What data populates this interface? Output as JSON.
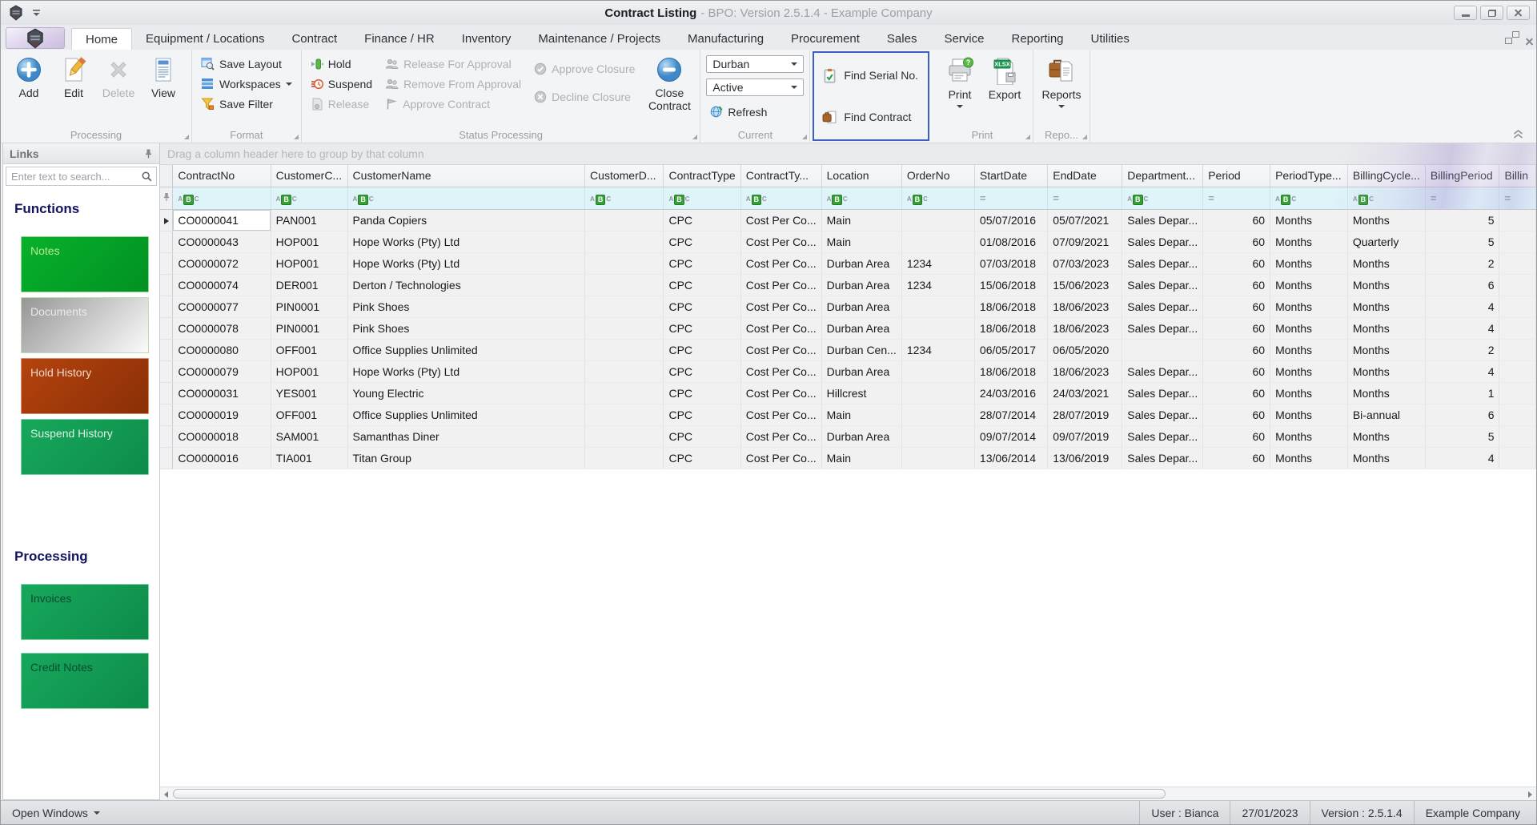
{
  "titlebar": {
    "title": "Contract Listing",
    "subtitle": "- BPO: Version 2.5.1.4 - Example Company"
  },
  "tabs": [
    {
      "label": "Home",
      "active": true
    },
    {
      "label": "Equipment / Locations"
    },
    {
      "label": "Contract"
    },
    {
      "label": "Finance / HR"
    },
    {
      "label": "Inventory"
    },
    {
      "label": "Maintenance / Projects"
    },
    {
      "label": "Manufacturing"
    },
    {
      "label": "Procurement"
    },
    {
      "label": "Sales"
    },
    {
      "label": "Service"
    },
    {
      "label": "Reporting"
    },
    {
      "label": "Utilities"
    }
  ],
  "ribbon": {
    "processing": {
      "label": "Processing",
      "add": "Add",
      "edit": "Edit",
      "del": "Delete",
      "view": "View"
    },
    "format": {
      "label": "Format",
      "save_layout": "Save Layout",
      "workspaces": "Workspaces",
      "save_filter": "Save Filter"
    },
    "status": {
      "label": "Status Processing",
      "hold": "Hold",
      "suspend": "Suspend",
      "release": "Release",
      "release_for_approval": "Release For Approval",
      "remove_from_approval": "Remove From Approval",
      "approve_contract": "Approve Contract",
      "approve_closure": "Approve Closure",
      "decline_closure": "Decline Closure",
      "close_contract": "Close Contract"
    },
    "current": {
      "label": "Current",
      "branch": "Durban",
      "state": "Active",
      "refresh": "Refresh"
    },
    "find": {
      "find_serial": "Find Serial No.",
      "find_contract": "Find Contract"
    },
    "print": {
      "label": "Print",
      "print_btn": "Print",
      "export_btn": "Export",
      "export_badge": "XLSX"
    },
    "reports": {
      "label": "Repo...",
      "reports_btn": "Reports"
    }
  },
  "sidebar": {
    "caption": "Links",
    "search_placeholder": "Enter text to search...",
    "functions": {
      "heading": "Functions",
      "buttons": [
        {
          "label": "Notes",
          "style": "green"
        },
        {
          "label": "Documents",
          "style": "silver"
        },
        {
          "label": "Hold History",
          "style": "rust"
        },
        {
          "label": "Suspend History",
          "style": "emerald"
        }
      ]
    },
    "processing": {
      "heading": "Processing",
      "buttons": [
        {
          "label": "Invoices",
          "style": "emerald2"
        },
        {
          "label": "Credit Notes",
          "style": "emerald2"
        }
      ]
    }
  },
  "grid": {
    "group_hint": "Drag a column header here to group by that column",
    "filter_icons": {
      "abc": [
        "A",
        "B",
        "C"
      ],
      "eq": "="
    },
    "columns": [
      {
        "label": "ContractNo",
        "filter": "abc"
      },
      {
        "label": "CustomerC...",
        "filter": "abc"
      },
      {
        "label": "CustomerName",
        "filter": "abc"
      },
      {
        "label": "CustomerD...",
        "filter": "abc"
      },
      {
        "label": "ContractType",
        "filter": "abc"
      },
      {
        "label": "ContractTy...",
        "filter": "abc"
      },
      {
        "label": "Location",
        "filter": "abc"
      },
      {
        "label": "OrderNo",
        "filter": "abc"
      },
      {
        "label": "StartDate",
        "filter": "eq"
      },
      {
        "label": "EndDate",
        "filter": "eq"
      },
      {
        "label": "Department...",
        "filter": "abc"
      },
      {
        "label": "Period",
        "filter": "eq",
        "align": "right"
      },
      {
        "label": "PeriodType...",
        "filter": "abc"
      },
      {
        "label": "BillingCycle...",
        "filter": "abc"
      },
      {
        "label": "BillingPeriod",
        "filter": "eq",
        "align": "right"
      },
      {
        "label": "Billin",
        "filter": "eq"
      }
    ],
    "rows": [
      [
        "CO0000041",
        "PAN001",
        "Panda Copiers",
        "",
        "CPC",
        "Cost Per Co...",
        "Main",
        "",
        "05/07/2016",
        "05/07/2021",
        "Sales Depar...",
        "60",
        "Months",
        "Months",
        "5",
        ""
      ],
      [
        "CO0000043",
        "HOP001",
        "Hope Works (Pty) Ltd",
        "",
        "CPC",
        "Cost Per Co...",
        "Main",
        "",
        "01/08/2016",
        "07/09/2021",
        "Sales Depar...",
        "60",
        "Months",
        "Quarterly",
        "5",
        ""
      ],
      [
        "CO0000072",
        "HOP001",
        "Hope Works (Pty) Ltd",
        "",
        "CPC",
        "Cost Per Co...",
        "Durban Area",
        "1234",
        "07/03/2018",
        "07/03/2023",
        "Sales Depar...",
        "60",
        "Months",
        "Months",
        "2",
        ""
      ],
      [
        "CO0000074",
        "DER001",
        "Derton / Technologies",
        "",
        "CPC",
        "Cost Per Co...",
        "Durban Area",
        "1234",
        "15/06/2018",
        "15/06/2023",
        "Sales Depar...",
        "60",
        "Months",
        "Months",
        "6",
        ""
      ],
      [
        "CO0000077",
        "PIN0001",
        "Pink Shoes",
        "",
        "CPC",
        "Cost Per Co...",
        "Durban Area",
        "",
        "18/06/2018",
        "18/06/2023",
        "Sales Depar...",
        "60",
        "Months",
        "Months",
        "4",
        ""
      ],
      [
        "CO0000078",
        "PIN0001",
        "Pink Shoes",
        "",
        "CPC",
        "Cost Per Co...",
        "Durban Area",
        "",
        "18/06/2018",
        "18/06/2023",
        "Sales Depar...",
        "60",
        "Months",
        "Months",
        "4",
        ""
      ],
      [
        "CO0000080",
        "OFF001",
        "Office Supplies Unlimited",
        "",
        "CPC",
        "Cost Per Co...",
        "Durban Cen...",
        "1234",
        "06/05/2017",
        "06/05/2020",
        "",
        "60",
        "Months",
        "Months",
        "2",
        ""
      ],
      [
        "CO0000079",
        "HOP001",
        "Hope Works (Pty) Ltd",
        "",
        "CPC",
        "Cost Per Co...",
        "Durban Area",
        "",
        "18/06/2018",
        "18/06/2023",
        "Sales Depar...",
        "60",
        "Months",
        "Months",
        "4",
        ""
      ],
      [
        "CO0000031",
        "YES001",
        "Young Electric",
        "",
        "CPC",
        "Cost Per Co...",
        "Hillcrest",
        "",
        "24/03/2016",
        "24/03/2021",
        "Sales Depar...",
        "60",
        "Months",
        "Months",
        "1",
        ""
      ],
      [
        "CO0000019",
        "OFF001",
        "Office Supplies Unlimited",
        "",
        "CPC",
        "Cost Per Co...",
        "Main",
        "",
        "28/07/2014",
        "28/07/2019",
        "Sales Depar...",
        "60",
        "Months",
        "Bi-annual",
        "6",
        ""
      ],
      [
        "CO0000018",
        "SAM001",
        "Samanthas Diner",
        "",
        "CPC",
        "Cost Per Co...",
        "Durban Area",
        "",
        "09/07/2014",
        "09/07/2019",
        "Sales Depar...",
        "60",
        "Months",
        "Months",
        "5",
        ""
      ],
      [
        "CO0000016",
        "TIA001",
        "Titan Group",
        "",
        "CPC",
        "Cost Per Co...",
        "Main",
        "",
        "13/06/2014",
        "13/06/2019",
        "Sales Depar...",
        "60",
        "Months",
        "Months",
        "4",
        ""
      ]
    ]
  },
  "statusbar": {
    "open_windows": "Open Windows",
    "right_items": [
      "User : Bianca",
      "27/01/2023",
      "Version : 2.5.1.4",
      "Example Company"
    ]
  }
}
